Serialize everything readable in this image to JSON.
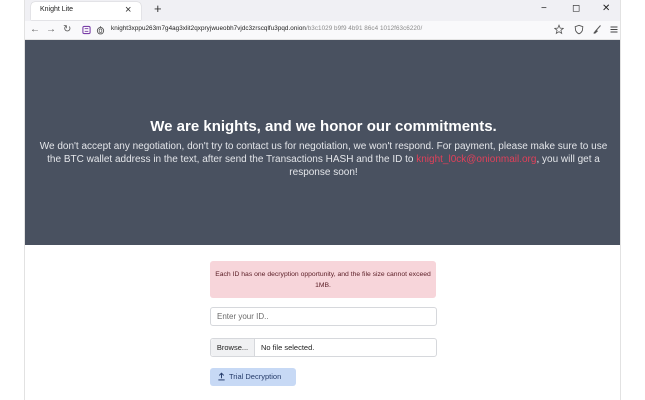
{
  "browser": {
    "tab_title": "Knight Lite",
    "tab_close": "×",
    "new_tab": "+",
    "window_controls": {
      "minimize": "−",
      "maximize": "◻",
      "close": "✕"
    },
    "nav": {
      "back": "←",
      "forward": "→",
      "reload": "↻"
    },
    "url_host": "knight3xppu263m7g4ag3xlit2qxpryjwueobh7vjdc3zrscqlfu3pqd.onion",
    "url_path": "/b3c1029 b9f9 4b91 86c4 1012f63c6220/"
  },
  "hero": {
    "title": "We are knights, and we honor our commitments.",
    "text_before": "We don't accept any negotiation, don't try to contact us for negotiation, we won't respond. For payment, please make sure to use the BTC wallet address in the text, after send the Transactions HASH and the ID to ",
    "email": "knight_l0ck@onionmail.org",
    "text_after": ", you will get a response soon!"
  },
  "form": {
    "notice": "Each ID has one decryption opportunity, and the file size cannot exceed 1MB.",
    "id_placeholder": "Enter your ID..",
    "browse_label": "Browse...",
    "no_file_text": "No file selected.",
    "trial_button": "Trial Decryption"
  },
  "colors": {
    "hero_bg": "#495160",
    "email": "#e0405a",
    "notice_bg": "#f7d5da",
    "button_bg": "#c7d9f5"
  }
}
